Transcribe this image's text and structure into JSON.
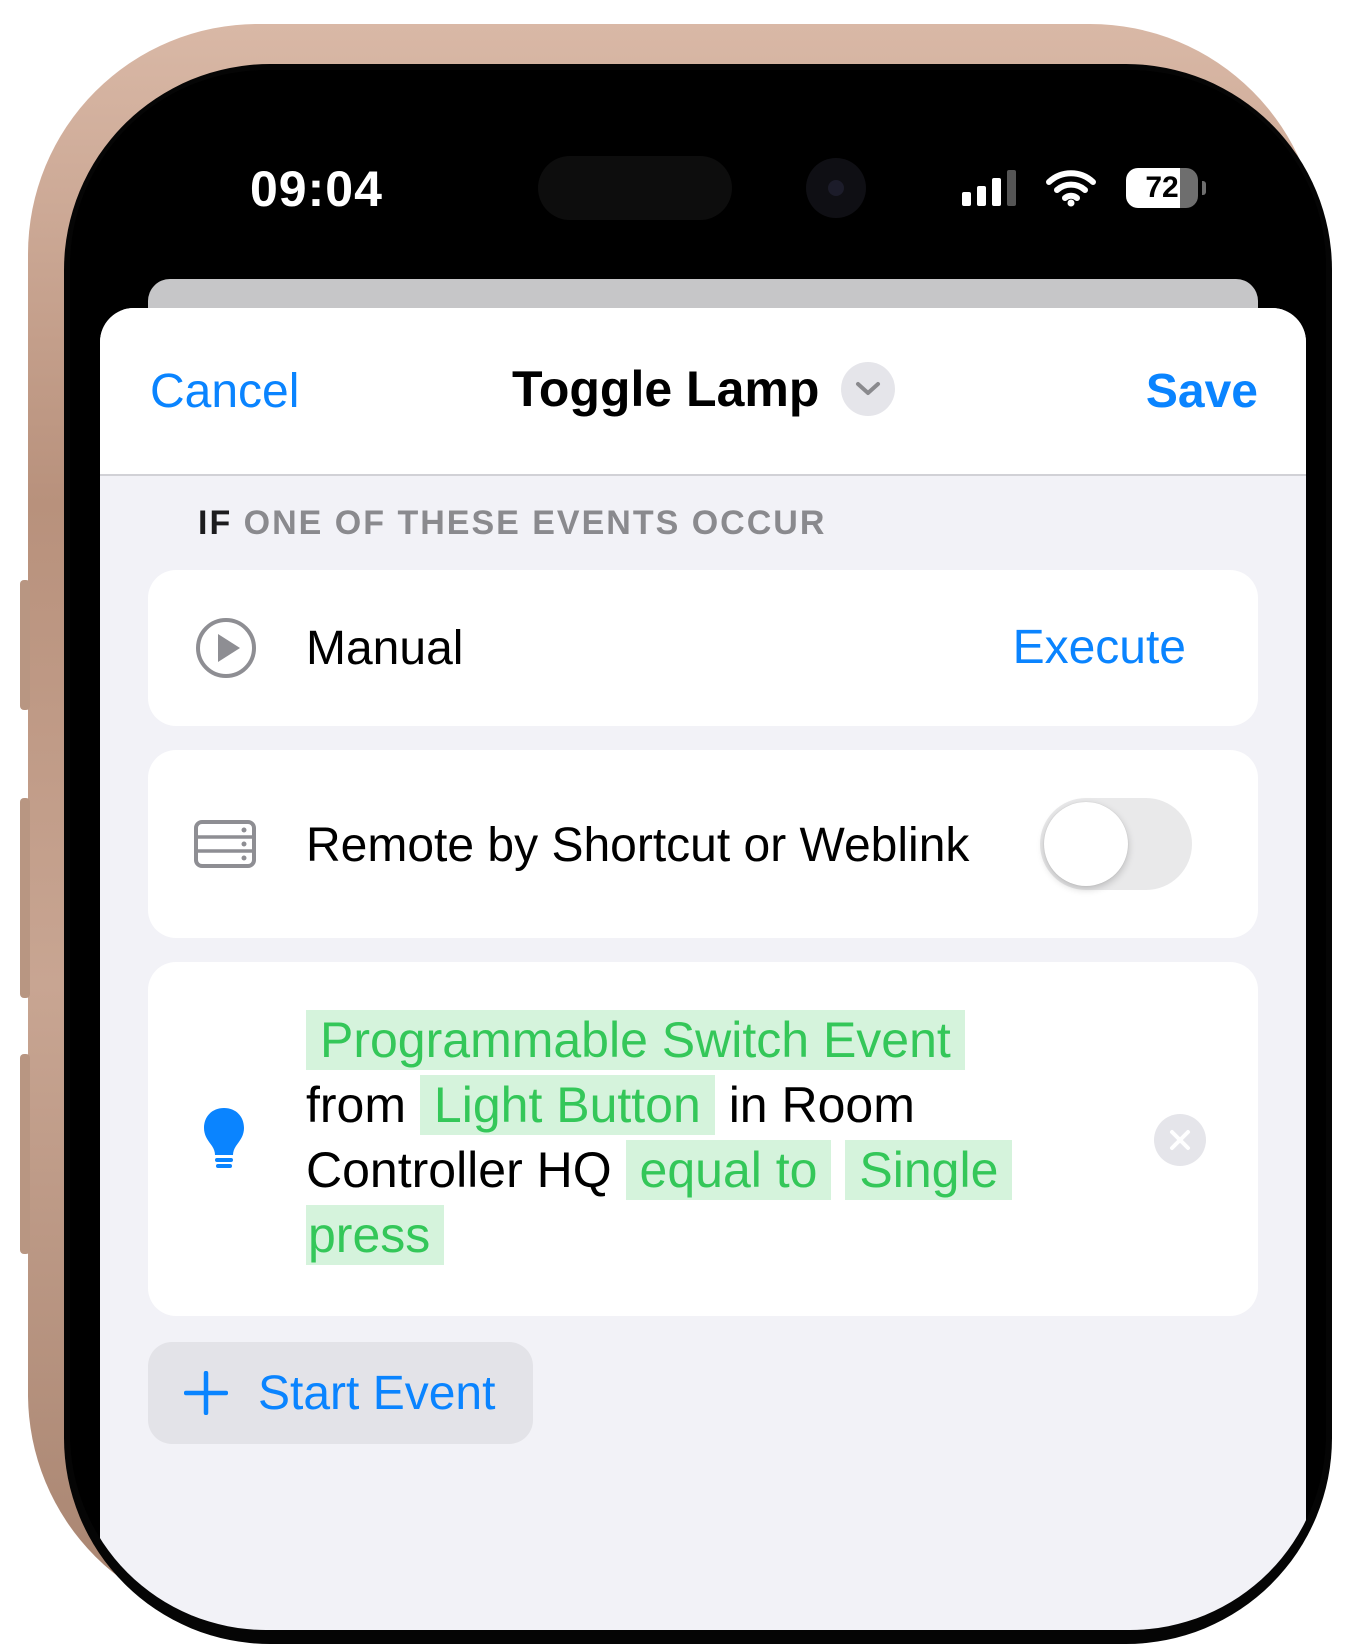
{
  "status_bar": {
    "time": "09:04",
    "battery_level": "72",
    "icons": [
      "cellular-signal-icon",
      "wifi-icon",
      "battery-icon"
    ]
  },
  "nav": {
    "cancel_label": "Cancel",
    "title": "Toggle Lamp",
    "title_menu_icon": "chevron-down-icon",
    "save_label": "Save"
  },
  "section": {
    "if_label": "IF",
    "header_rest": "ONE OF THESE EVENTS OCCUR"
  },
  "events": {
    "manual": {
      "icon": "play-circle-icon",
      "label": "Manual",
      "action_label": "Execute"
    },
    "remote": {
      "icon": "server-icon",
      "label": "Remote by Shortcut or Weblink",
      "toggle_on": false
    },
    "switch_event": {
      "icon": "lightbulb-icon",
      "event_type": "Programmable Switch Event",
      "from_word": "from",
      "accessory": "Light Button",
      "in_room_word": "in Room",
      "room": "Controller HQ",
      "operator": "equal to",
      "value_part1": "Single",
      "value_part2": "press",
      "remove_icon": "close-icon"
    }
  },
  "start_event": {
    "icon": "plus-icon",
    "label": "Start Event"
  },
  "colors": {
    "accent_blue": "#0a84ff",
    "token_green": "#34c759",
    "token_green_bg": "#d5f3dc",
    "grouped_background": "#f2f2f7"
  }
}
